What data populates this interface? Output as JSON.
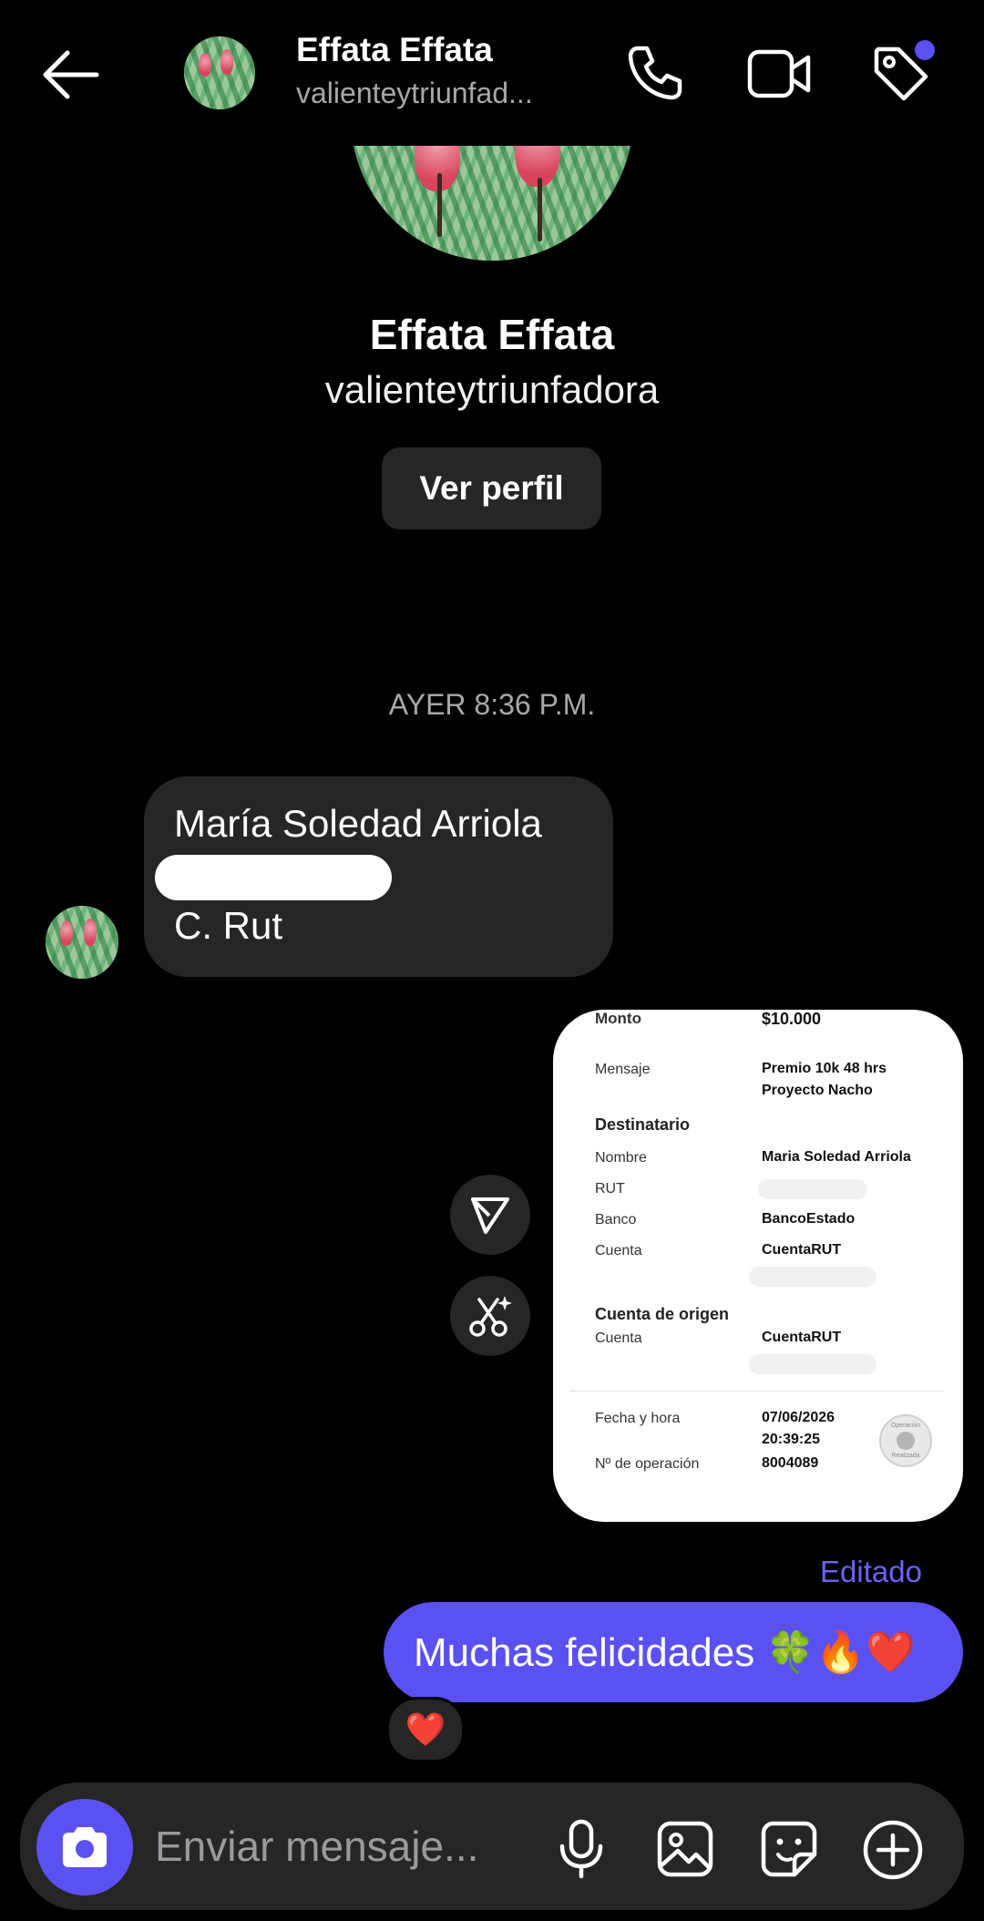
{
  "header": {
    "back_icon": "arrow-left-icon",
    "name": "Effata Effata",
    "username_truncated": "valienteytriunfad...",
    "call_icon": "phone-icon",
    "video_icon": "video-camera-icon",
    "tag_icon": "tag-icon",
    "notification_dot_color": "#5b51f2"
  },
  "profile": {
    "name": "Effata Effata",
    "username": "valienteytriunfadora",
    "view_profile_label": "Ver perfil"
  },
  "timestamp": "AYER 8:36 P.M.",
  "incoming_message": {
    "line1": "María Soledad Arriola",
    "line3": "C. Rut"
  },
  "receipt": {
    "monto_label": "Monto",
    "monto_value": "$10.000",
    "mensaje_label": "Mensaje",
    "mensaje_value_1": "Premio 10k 48 hrs",
    "mensaje_value_2": "Proyecto Nacho",
    "destinatario_title": "Destinatario",
    "nombre_label": "Nombre",
    "nombre_value": "Maria Soledad Arriola",
    "rut_label": "RUT",
    "banco_label": "Banco",
    "banco_value": "BancoEstado",
    "cuenta_label": "Cuenta",
    "cuenta_value": "CuentaRUT",
    "origen_title": "Cuenta de origen",
    "origen_cuenta_label": "Cuenta",
    "origen_cuenta_value": "CuentaRUT",
    "fecha_label": "Fecha y hora",
    "fecha_value_1": "07/06/2026",
    "fecha_value_2": "20:39:25",
    "operacion_label": "Nº de operación",
    "operacion_value": "8004089",
    "stamp_text_top": "Operación",
    "stamp_text_bottom": "Realizada"
  },
  "side_actions": {
    "share_icon": "send-icon",
    "ai_edit_icon": "scissors-sparkle-icon"
  },
  "edited_label": "Editado",
  "outgoing_message": {
    "text": "Muchas felicidades 🍀🔥❤️"
  },
  "reaction": "❤️",
  "composer": {
    "camera_icon": "camera-icon",
    "placeholder": "Enviar mensaje...",
    "mic_icon": "microphone-icon",
    "gallery_icon": "image-icon",
    "sticker_icon": "sticker-icon",
    "plus_icon": "plus-circle-icon",
    "camera_button_color": "#5b51f2"
  }
}
